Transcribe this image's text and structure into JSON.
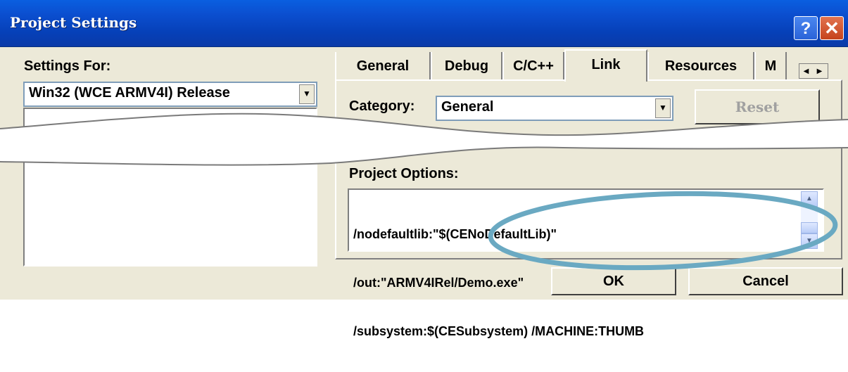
{
  "window": {
    "title": "Project Settings",
    "help_glyph": "?",
    "close_glyph": "✕"
  },
  "left": {
    "settings_for_label": "Settings For:",
    "config_value": "Win32 (WCE ARMV4I) Release"
  },
  "tabs": [
    {
      "label": "General"
    },
    {
      "label": "Debug"
    },
    {
      "label": "C/C++"
    },
    {
      "label": "Link",
      "active": true
    },
    {
      "label": "Resources"
    },
    {
      "label": "M"
    }
  ],
  "link": {
    "category_label": "Category:",
    "category_value": "General",
    "reset_label": "Reset",
    "project_options_label": "Project Options:",
    "options_lines": [
      "/nodefaultlib:\"$(CENoDefaultLib)\"",
      "/out:\"ARMV4IRel/Demo.exe\"",
      "/subsystem:$(CESubsystem) /MACHINE:THUMB"
    ]
  },
  "buttons": {
    "ok": "OK",
    "cancel": "Cancel"
  },
  "annotation": {
    "highlight_color": "#6aa9c2"
  }
}
